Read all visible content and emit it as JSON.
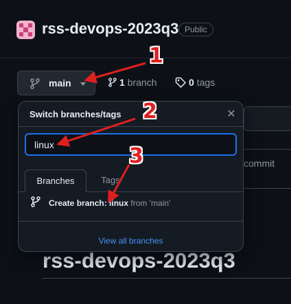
{
  "repo": {
    "name": "rss-devops-2023q3",
    "visibility": "Public"
  },
  "branch_selector": {
    "current_branch": "main"
  },
  "stats": {
    "branches_count": "1",
    "branches_label": "branch",
    "tags_count": "0",
    "tags_label": "tags"
  },
  "background": {
    "commit_label": "commit",
    "readme_heading": "rss-devops-2023q3"
  },
  "popover": {
    "title": "Switch branches/tags",
    "filter_value": "linux",
    "tabs": [
      "Branches",
      "Tags"
    ],
    "create_prefix": "Create branch:",
    "create_name": "linux",
    "create_from": "from 'main'",
    "view_all": "View all branches"
  },
  "annotations": {
    "numbers": [
      "1",
      "2",
      "3"
    ],
    "color": "#e01f1f"
  },
  "colors": {
    "background": "#0d1117",
    "accent_blue": "#1f6feb",
    "link_blue": "#4493f8"
  }
}
